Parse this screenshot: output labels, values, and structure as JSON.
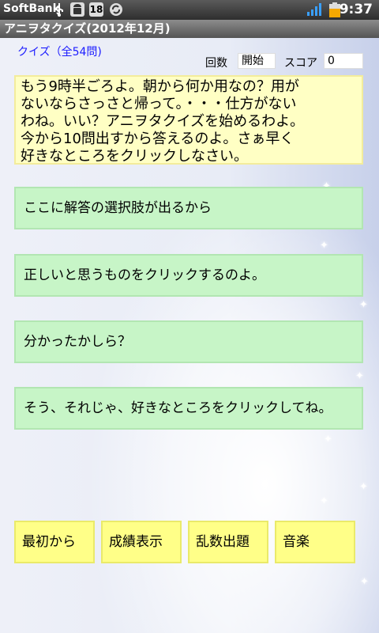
{
  "status_bar": {
    "carrier": "SoftBank",
    "time": "9:37",
    "notification_icons": [
      "usb-icon",
      "android-icon",
      "18-badge-icon",
      "sync-icon"
    ]
  },
  "title_bar": {
    "title": "アニヲタクイズ(2012年12月)"
  },
  "quiz": {
    "header": "クイズ（全54問)",
    "count_label": "回数",
    "count_value": "開始",
    "score_label": "スコア",
    "score_value": "0"
  },
  "speech": {
    "lines": [
      "もう9時半ごろよ。朝から何か用なの？用が",
      "ないならさっさと帰って。・・・仕方がない",
      "わね。いい？アニヲタクイズを始めるわよ。",
      "今から10問出すから答えるのよ。さぁ早く",
      "好きなところをクリックしなさい。"
    ]
  },
  "answers": [
    "ここに解答の選択肢が出るから",
    "正しいと思うものをクリックするのよ。",
    "分かったかしら？",
    "そう、それじゃ、好きなところをクリックしてね。"
  ],
  "buttons": {
    "restart": "最初から",
    "results": "成績表示",
    "random": "乱数出題",
    "music": "音楽"
  }
}
